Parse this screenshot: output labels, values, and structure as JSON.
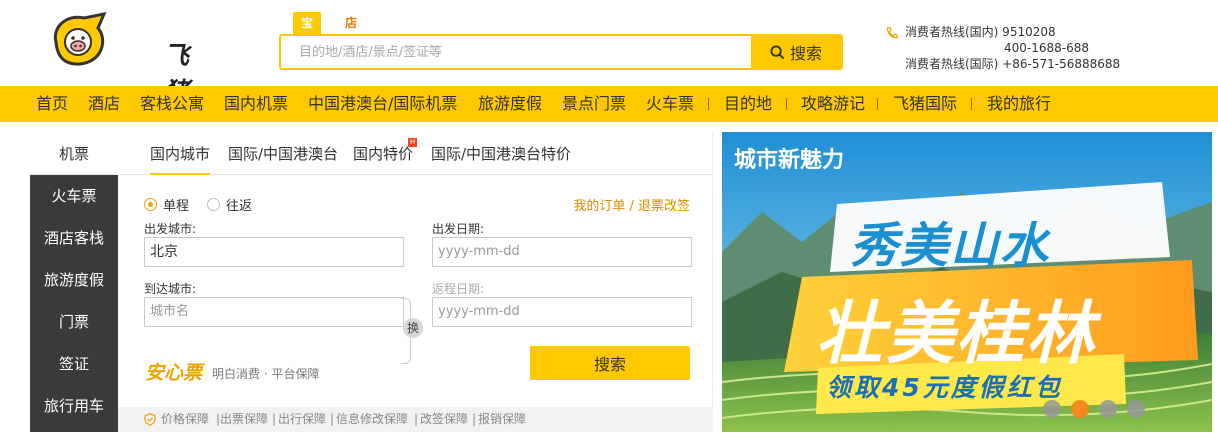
{
  "header": {
    "brand": "飞猪",
    "search_tabs": [
      "宝贝",
      "店铺"
    ],
    "search_placeholder": "目的地/酒店/景点/签证等",
    "search_button": "搜索",
    "hotline": {
      "line1": "消费者热线(国内)  9510208",
      "line2": "400-1688-688",
      "line3": "消费者热线(国际)  +86-571-56888688"
    }
  },
  "nav": {
    "items": [
      "首页",
      "酒店",
      "客栈公寓",
      "国内机票",
      "中国港澳台/国际机票",
      "旅游度假",
      "景点门票",
      "火车票",
      "目的地",
      "攻略游记",
      "飞猪国际",
      "我的旅行"
    ]
  },
  "booking": {
    "main_tab": "机票",
    "sub_tabs": [
      "国内城市",
      "国际/中国港澳台",
      "国内特价",
      "国际/中国港澳台特价"
    ],
    "hot_badge": "H",
    "sidebar": [
      "火车票",
      "酒店客栈",
      "旅游度假",
      "门票",
      "签证",
      "旅行用车"
    ],
    "trip_types": [
      "单程",
      "往返"
    ],
    "order_link": "我的订单 / 退票改签",
    "depart_city_label": "出发城市:",
    "depart_city_value": "北京",
    "arrive_city_label": "到达城市:",
    "arrive_city_placeholder": "城市名",
    "depart_date_label": "出发日期:",
    "depart_date_placeholder": "yyyy-mm-dd",
    "return_date_label": "返程日期:",
    "return_date_placeholder": "yyyy-mm-dd",
    "swap_label": "换",
    "anxin_brand": "安心票",
    "anxin_sub": "明白消费 · 平台保障",
    "submit": "搜索",
    "guarantees": [
      "价格保障",
      "出票保障",
      "出行保障",
      "信息修改保障",
      "改签保障",
      "报销保障"
    ]
  },
  "banner": {
    "title": "城市新魅力",
    "line1": "秀美山水",
    "line2": "壮美桂林",
    "line3": "领取45元度假红包",
    "active_slide": 2,
    "slide_count": 4
  },
  "colors": {
    "brand_yellow": "#ffc900",
    "accent_orange": "#e08b00",
    "sidebar_dark": "#3a3a3a"
  }
}
